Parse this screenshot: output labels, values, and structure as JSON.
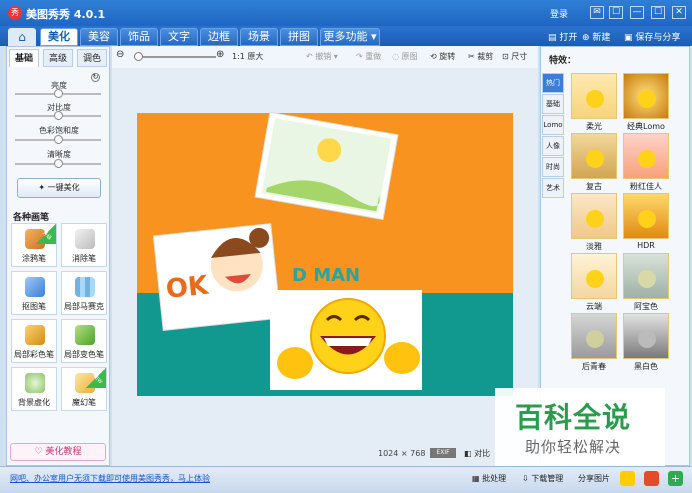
{
  "window": {
    "logo": "秀",
    "title": "美图秀秀 4.0.1",
    "login": "登录",
    "buttons": [
      "✉",
      "☐",
      "—",
      "☐",
      "✕"
    ]
  },
  "menubar": {
    "home_icon": "home-icon",
    "tabs": [
      "美化",
      "美容",
      "饰品",
      "文字",
      "边框",
      "场景",
      "拼图",
      "更多功能 ▾"
    ],
    "active_tab": "美化",
    "open": "打开",
    "new": "新建",
    "save_share": "保存与分享"
  },
  "toolbar": {
    "zoom_label": "1:1 原大",
    "undo": "撤销",
    "redo": "重做",
    "original": "原图",
    "rotate": "旋转",
    "crop": "裁剪",
    "size": "尺寸"
  },
  "left_panel": {
    "tabs": [
      "基础",
      "高级",
      "调色"
    ],
    "adjust": [
      "亮度",
      "对比度",
      "色彩饱和度",
      "清晰度"
    ],
    "adjust_levels": [
      0.5,
      0.5,
      0.5,
      0.5
    ],
    "onekey": "一键美化",
    "section_title": "各种画笔",
    "brushes": [
      {
        "label": "涂鸦笔",
        "badge": "升级"
      },
      {
        "label": "消除笔",
        "badge": ""
      },
      {
        "label": "抠图笔",
        "badge": ""
      },
      {
        "label": "局部马赛克",
        "badge": ""
      },
      {
        "label": "局部彩色笔",
        "badge": ""
      },
      {
        "label": "局部变色笔",
        "badge": ""
      },
      {
        "label": "背景虚化",
        "badge": ""
      },
      {
        "label": "魔幻笔",
        "badge": "NEW"
      }
    ],
    "tutorial": "美化教程"
  },
  "canvas": {
    "image_size": "1024 × 768",
    "exif": "EXIF",
    "compare": "对比",
    "ok_text": "OK",
    "man_text": "D MAN"
  },
  "right_panel": {
    "title": "特效：",
    "categories": [
      "热门",
      "基础",
      "Lomo",
      "人像",
      "时尚",
      "艺术"
    ],
    "active_category": "热门",
    "effects": [
      "柔光",
      "经典Lomo",
      "复古",
      "粉红佳人",
      "淡雅",
      "HDR",
      "云端",
      "阿宝色",
      "后青春",
      "黑白色"
    ]
  },
  "statusbar": {
    "notice": "网吧、办公室用户无须下载即可使用美图秀秀，马上体验",
    "batch": "批处理",
    "download": "下载管理",
    "share_pic": "分享图片"
  },
  "watermark": {
    "main": "百科全说",
    "sub": "助你轻松解决"
  },
  "colors": {
    "title_blue": "#1f66c2",
    "accent_green": "#2b9b4d",
    "canvas_orange": "#f7931e",
    "canvas_teal": "#11988f"
  }
}
